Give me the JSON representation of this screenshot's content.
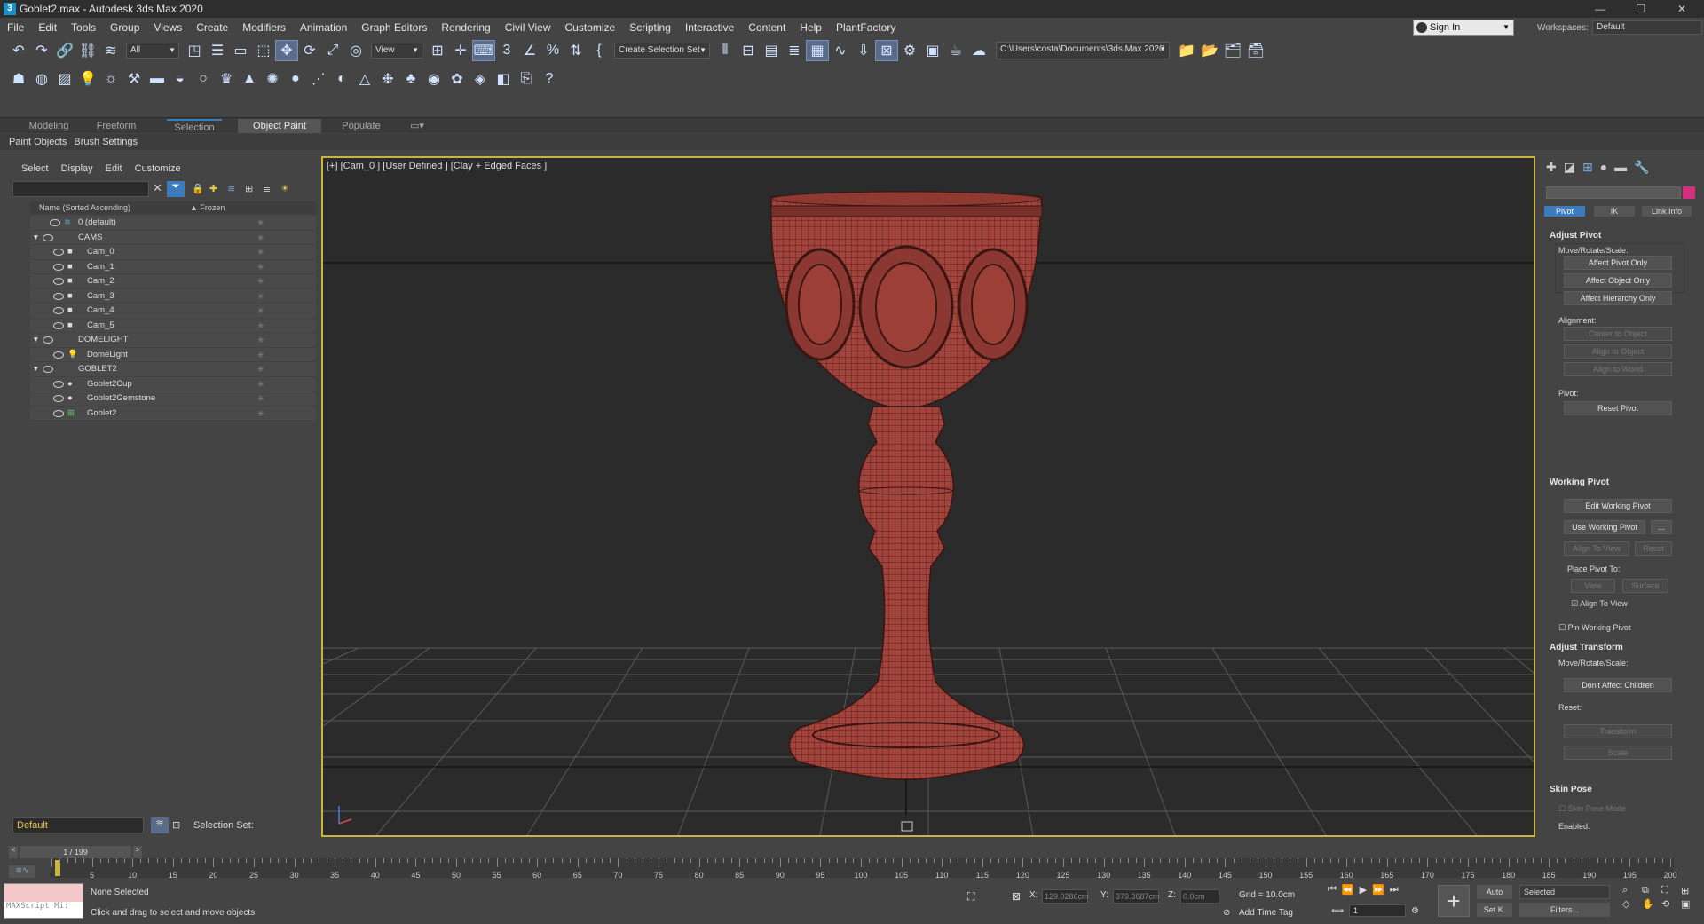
{
  "window": {
    "title": "Goblet2.max - Autodesk 3ds Max 2020",
    "app_icon": "3"
  },
  "menu": [
    "File",
    "Edit",
    "Tools",
    "Group",
    "Views",
    "Create",
    "Modifiers",
    "Animation",
    "Graph Editors",
    "Rendering",
    "Civil View",
    "Customize",
    "Scripting",
    "Interactive",
    "Content",
    "Help",
    "PlantFactory"
  ],
  "account": {
    "sign_in": "Sign In",
    "workspaces_label": "Workspaces:",
    "workspace": "Default"
  },
  "main_toolbar": {
    "selection_filter": "All",
    "ref_coord": "View",
    "named_selection": "Create Selection Set",
    "project_path": "C:\\Users\\costa\\Documents\\3ds Max 2020"
  },
  "ribbon": {
    "tabs": [
      "Modeling",
      "Freeform",
      "Selection",
      "Object Paint",
      "Populate"
    ],
    "active_tab": "Object Paint",
    "subtabs": [
      "Paint Objects",
      "Brush Settings"
    ]
  },
  "scene_explorer": {
    "menu": [
      "Select",
      "Display",
      "Edit",
      "Customize"
    ],
    "header": {
      "name_col": "Name (Sorted Ascending)",
      "frozen_col": "▲ Frozen"
    },
    "rows": [
      {
        "name": "0 (default)"
      },
      {
        "name": "CAMS"
      },
      {
        "name": "Cam_0"
      },
      {
        "name": "Cam_1"
      },
      {
        "name": "Cam_2"
      },
      {
        "name": "Cam_3"
      },
      {
        "name": "Cam_4"
      },
      {
        "name": "Cam_5"
      },
      {
        "name": "DOMELIGHT"
      },
      {
        "name": "DomeLight"
      },
      {
        "name": "GOBLET2"
      },
      {
        "name": "Goblet2Cup"
      },
      {
        "name": "Goblet2Gemstone"
      },
      {
        "name": "Goblet2"
      }
    ],
    "layer": "Default",
    "selection_set_label": "Selection Set:"
  },
  "viewport": {
    "label": "[+] [Cam_0 ] [User Defined ] [Clay + Edged Faces ]"
  },
  "command_panel": {
    "subtabs": [
      "Pivot",
      "IK",
      "Link Info"
    ],
    "adjust_pivot": {
      "title": "Adjust Pivot",
      "mrs_label": "Move/Rotate/Scale:",
      "buttons": [
        "Affect Pivot Only",
        "Affect Object Only",
        "Affect Hierarchy Only"
      ],
      "alignment_label": "Alignment:",
      "align_buttons": [
        "Center to Object",
        "Align to Object",
        "Align to World"
      ],
      "pivot_label": "Pivot:",
      "reset_pivot": "Reset Pivot"
    },
    "working_pivot": {
      "title": "Working Pivot",
      "edit": "Edit Working Pivot",
      "use": "Use Working Pivot",
      "more": "...",
      "align_to_view": "Align To View",
      "reset": "Reset",
      "place_label": "Place Pivot To:",
      "view": "View",
      "surface": "Surface",
      "align_check": "Align To View",
      "pin": "Pin Working Pivot"
    },
    "adjust_transform": {
      "title": "Adjust Transform",
      "mrs_label": "Move/Rotate/Scale:",
      "dont_affect": "Don't Affect Children",
      "reset_label": "Reset:",
      "transform": "Transform",
      "scale": "Scale"
    },
    "skin_pose": {
      "title": "Skin Pose",
      "mode": "Skin Pose Mode",
      "enabled": "Enabled:"
    }
  },
  "timeline": {
    "frame_display": "1 / 199",
    "ticks": [
      5,
      10,
      15,
      20,
      25,
      30,
      35,
      40,
      45,
      50,
      55,
      60,
      65,
      70,
      75,
      80,
      85,
      90,
      95,
      100,
      105,
      110,
      115,
      120,
      125,
      130,
      135,
      140,
      145,
      150,
      155,
      160,
      165,
      170,
      175,
      180,
      185,
      190,
      195,
      200
    ]
  },
  "status": {
    "maxscript": "MAXScript Mi:",
    "selection": "None Selected",
    "prompt": "Click and drag to select and move objects",
    "x_label": "X:",
    "x_value": "129.0286cm",
    "y_label": "Y:",
    "y_value": "379.3687cm",
    "z_label": "Z:",
    "z_value": "0.0cm",
    "grid": "Grid = 10.0cm",
    "add_time_tag": "Add Time Tag",
    "auto": "Auto",
    "set_k": "Set K.",
    "key_mode": "Selected",
    "filters": "Filters...",
    "frame": "1"
  }
}
